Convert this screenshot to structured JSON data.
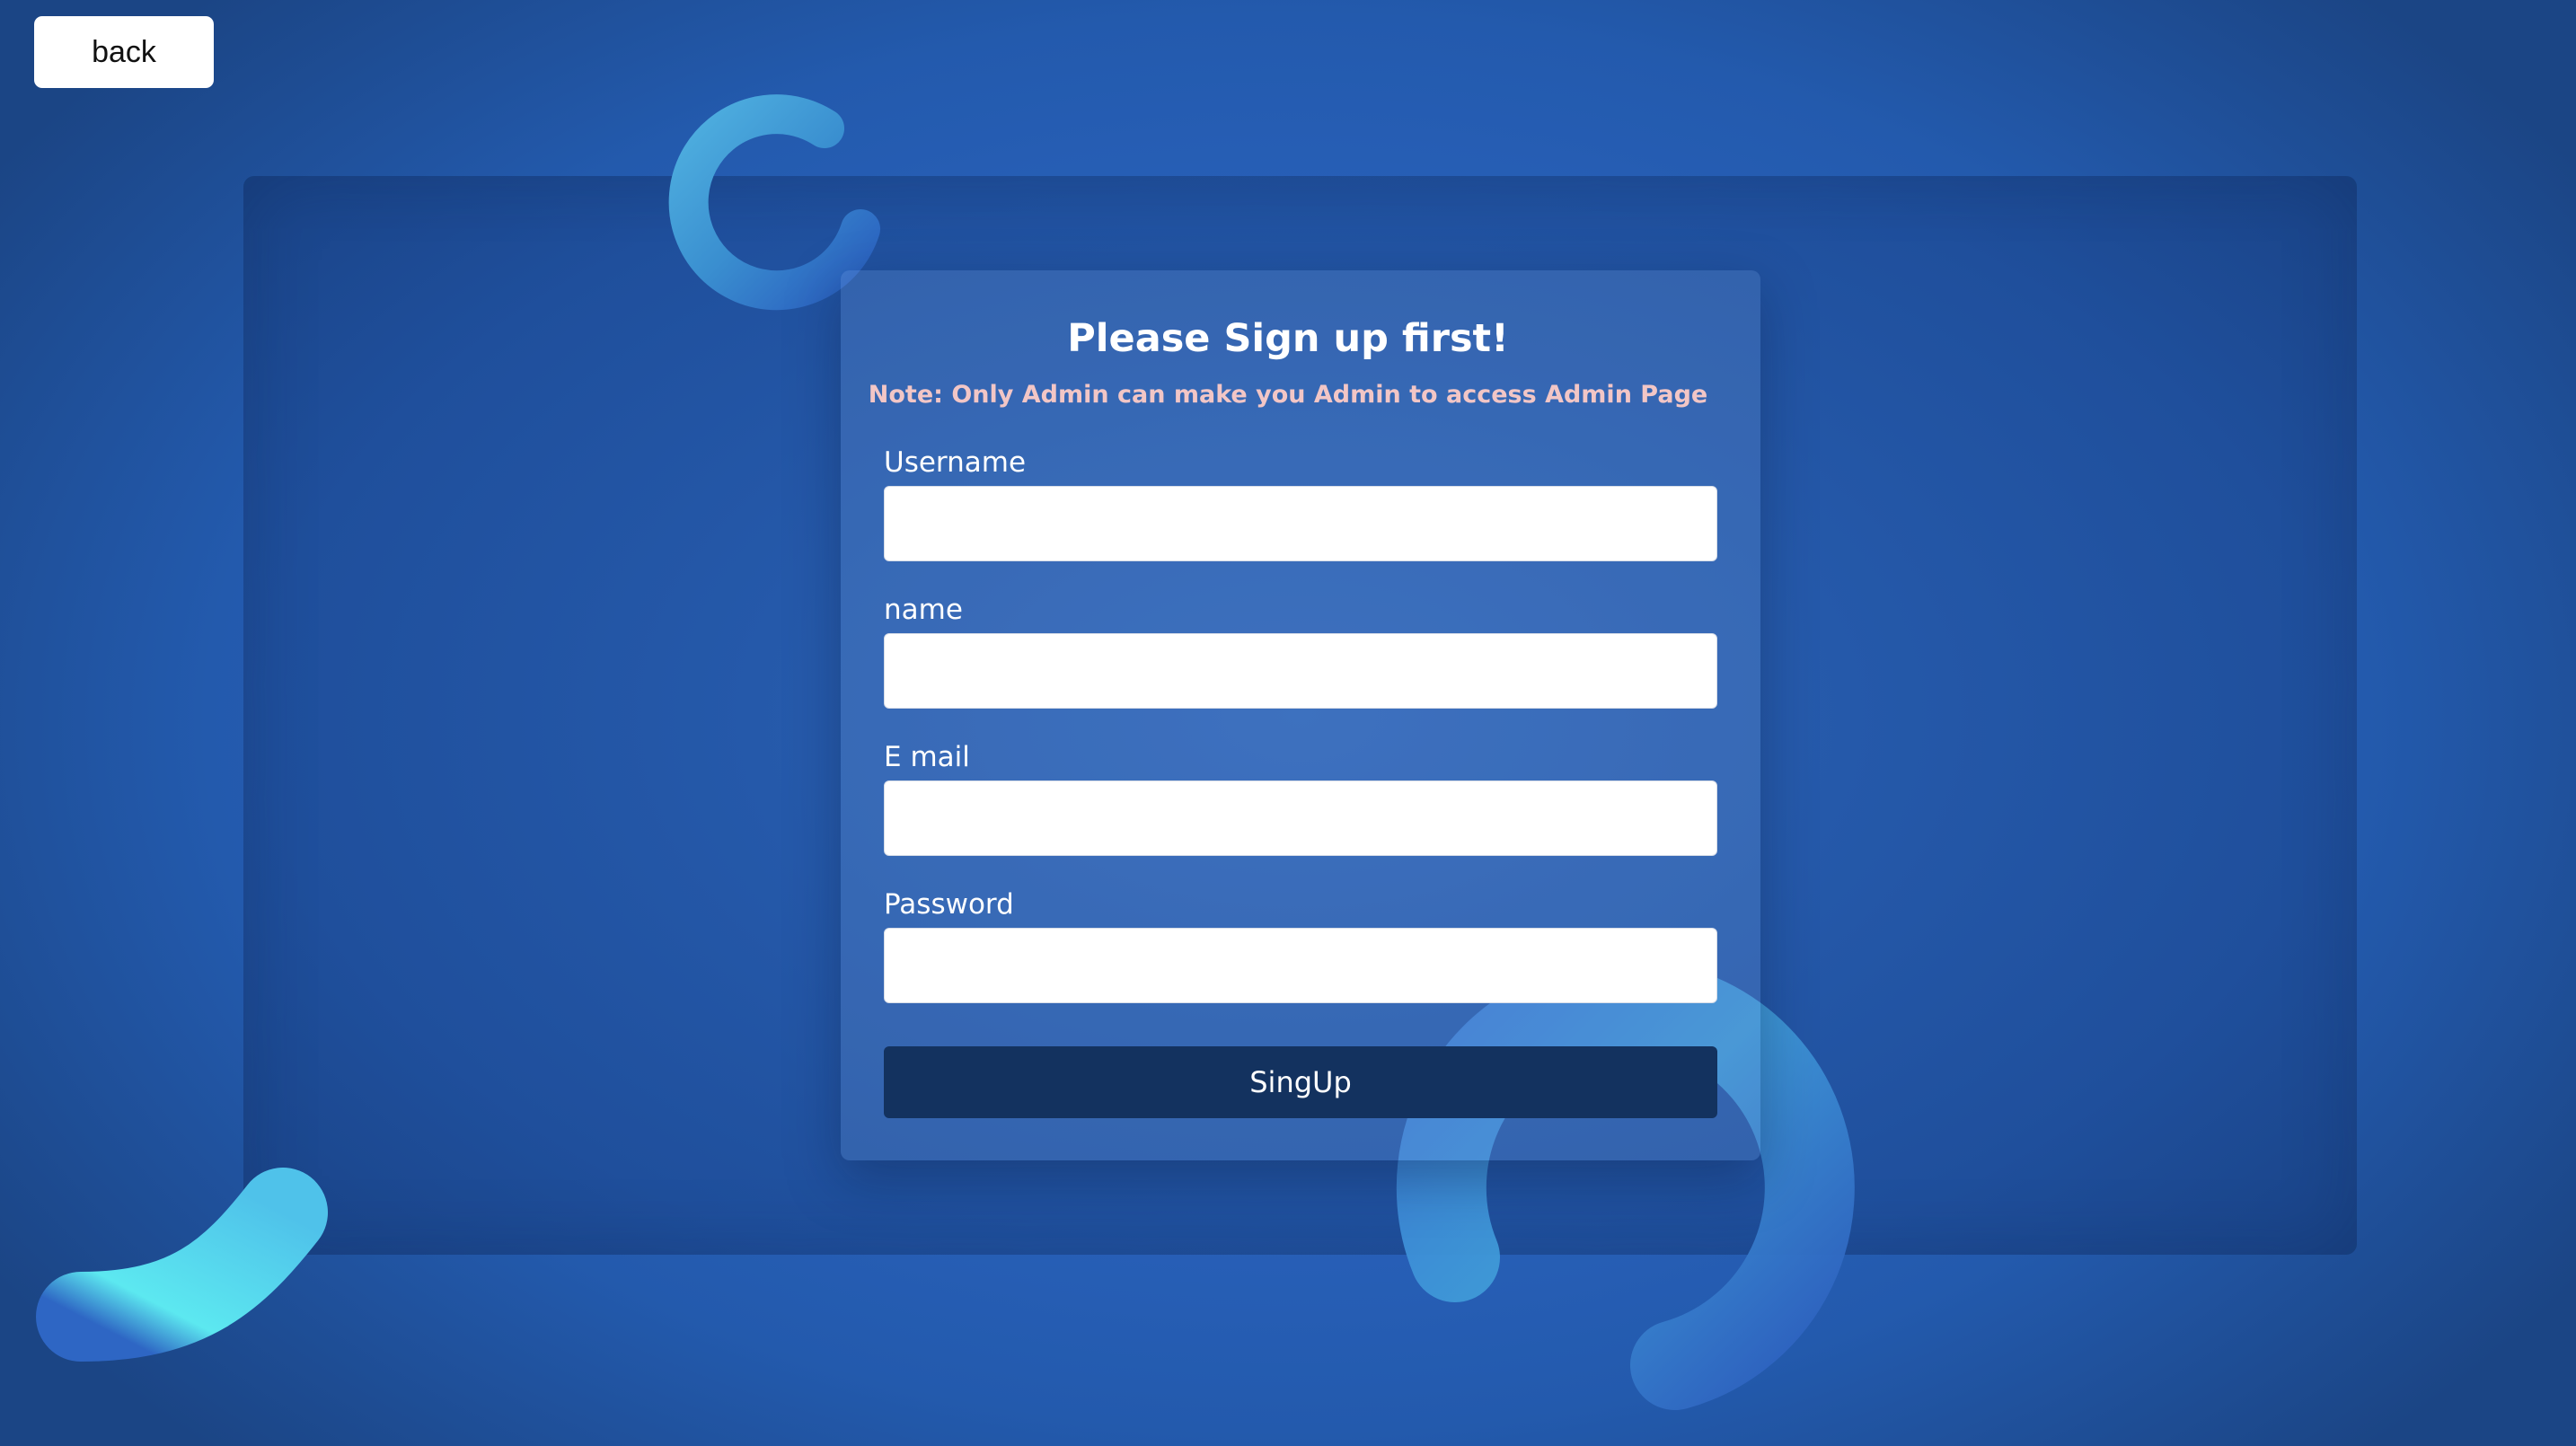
{
  "nav": {
    "back_label": "back"
  },
  "signup_form": {
    "title": "Please Sign up first!",
    "note": "Note: Only Admin can make you Admin to access Admin Page",
    "fields": [
      {
        "label": "Username",
        "value": "",
        "placeholder": ""
      },
      {
        "label": "name",
        "value": "",
        "placeholder": ""
      },
      {
        "label": "E mail",
        "value": "",
        "placeholder": ""
      },
      {
        "label": "Password",
        "value": "",
        "placeholder": ""
      }
    ],
    "submit_label": "SingUp"
  },
  "colors": {
    "background": "#2a62bd",
    "submit_button": "#13325f",
    "note_text": "#f2c6c6",
    "accent_shape": "#5ce8f0"
  },
  "decorations": [
    "ring-shape-top",
    "ring-shape-bottom-right",
    "tube-shape-bottom-left"
  ]
}
